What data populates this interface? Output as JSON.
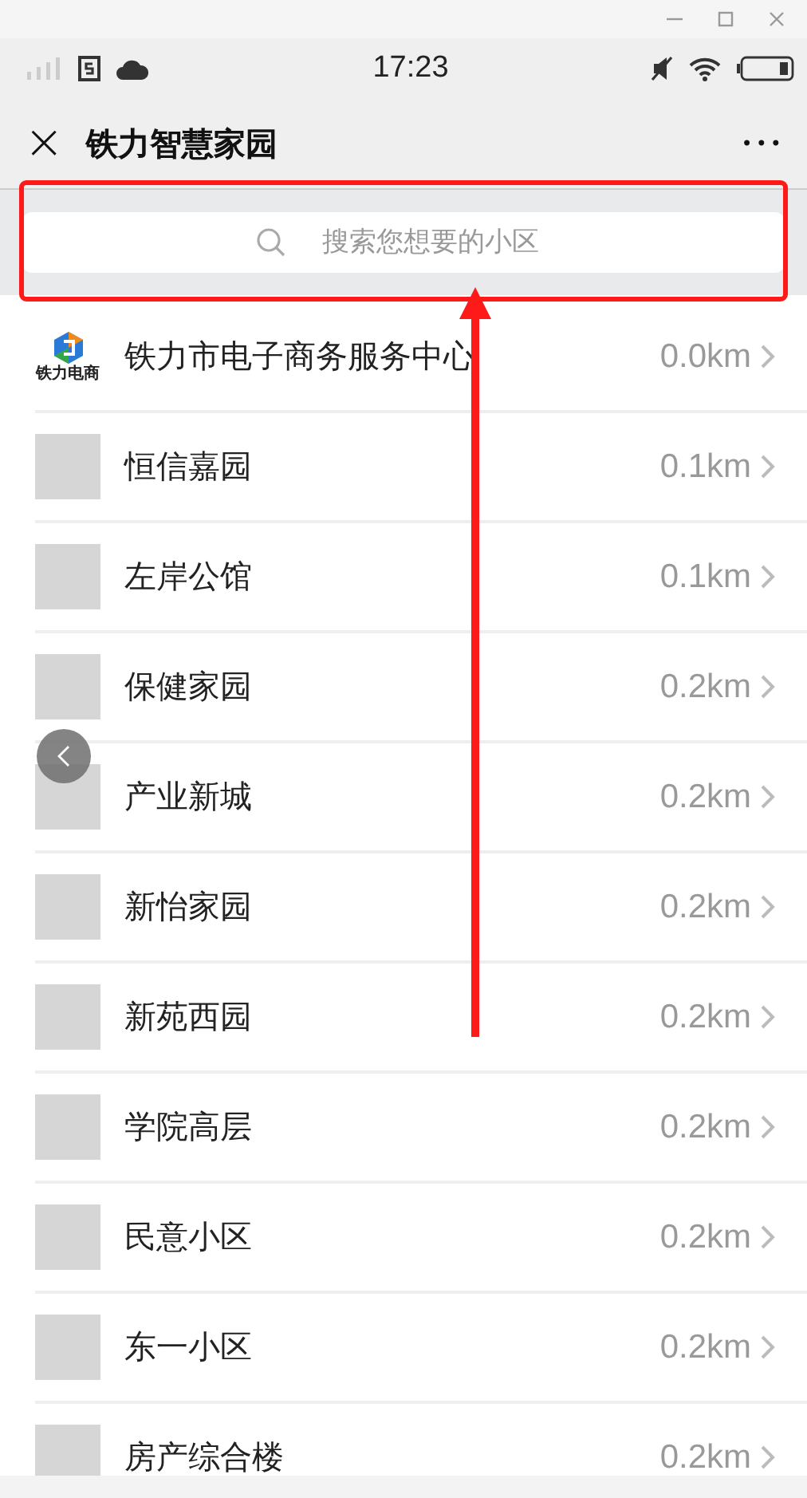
{
  "status_bar": {
    "time": "17:23"
  },
  "nav": {
    "close": "×",
    "title": "铁力智慧家园",
    "more": "•••"
  },
  "search": {
    "placeholder": "搜索您想要的小区"
  },
  "communities": [
    {
      "kind": "logo",
      "logo_text": "铁力电商",
      "name": "铁力市电子商务服务中心",
      "distance": "0.0km"
    },
    {
      "kind": "plain",
      "name": "恒信嘉园",
      "distance": "0.1km"
    },
    {
      "kind": "plain",
      "name": "左岸公馆",
      "distance": "0.1km"
    },
    {
      "kind": "plain",
      "name": "保健家园",
      "distance": "0.2km"
    },
    {
      "kind": "plain",
      "name": "产业新城",
      "distance": "0.2km"
    },
    {
      "kind": "plain",
      "name": "新怡家园",
      "distance": "0.2km"
    },
    {
      "kind": "plain",
      "name": "新苑西园",
      "distance": "0.2km"
    },
    {
      "kind": "plain",
      "name": "学院高层",
      "distance": "0.2km"
    },
    {
      "kind": "plain",
      "name": "民意小区",
      "distance": "0.2km"
    },
    {
      "kind": "plain",
      "name": "东一小区",
      "distance": "0.2km"
    },
    {
      "kind": "plain",
      "name": "房产综合楼",
      "distance": "0.2km"
    }
  ]
}
